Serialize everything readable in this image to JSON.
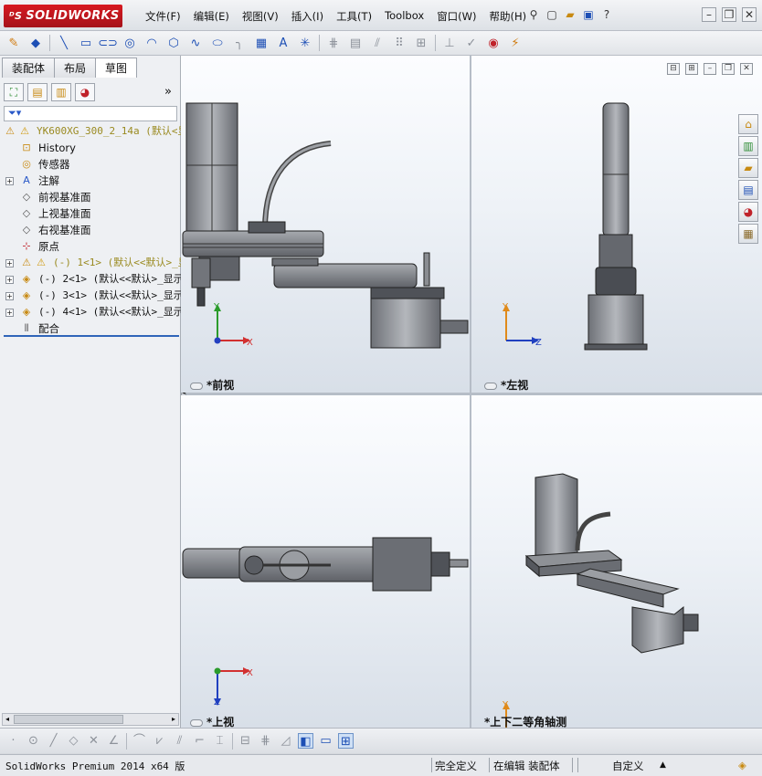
{
  "app": {
    "logo_text": "SOLIDWORKS",
    "menu": [
      "文件(F)",
      "编辑(E)",
      "视图(V)",
      "插入(I)",
      "工具(T)",
      "Toolbox",
      "窗口(W)",
      "帮助(H)"
    ],
    "title_tools": [
      "pin-icon",
      "new-document-icon",
      "open-icon",
      "save-icon",
      "help-icon"
    ],
    "window_controls": [
      "minimize-icon",
      "restore-icon",
      "close-icon"
    ]
  },
  "command_toolbar": [
    "smart-dimension-icon",
    "sketch-icon",
    "line-icon",
    "rectangle-icon",
    "slot-icon",
    "circle-icon",
    "arc-icon",
    "polygon-icon",
    "spline-icon",
    "ellipse-icon",
    "fillet-icon",
    "offset-icon",
    "text-icon",
    "point-icon",
    "trim-icon",
    "convert-icon",
    "mirror-icon",
    "linear-pattern-icon",
    "move-icon",
    "display-relations-icon",
    "repair-icon",
    "quick-snaps-icon",
    "rapid-sketch-icon"
  ],
  "left_panel": {
    "tabs": [
      "装配体",
      "布局",
      "草图"
    ],
    "active_tab": "草图",
    "panel_icons": [
      "feature-manager-icon",
      "property-manager-icon",
      "configuration-manager-icon",
      "display-manager-icon"
    ],
    "tree": [
      {
        "label": "YK600XG_300_2_14a  (默认<显",
        "icon": "assembly-warning-icon",
        "kind": "root",
        "expander": false
      },
      {
        "label": "History",
        "icon": "history-icon",
        "kind": "item",
        "expander": false
      },
      {
        "label": "传感器",
        "icon": "sensor-icon",
        "kind": "item",
        "expander": false
      },
      {
        "label": "注解",
        "icon": "annotation-icon",
        "kind": "item",
        "expander": true
      },
      {
        "label": "前视基准面",
        "icon": "plane-icon",
        "kind": "item",
        "expander": false
      },
      {
        "label": "上视基准面",
        "icon": "plane-icon",
        "kind": "item",
        "expander": false
      },
      {
        "label": "右视基准面",
        "icon": "plane-icon",
        "kind": "item",
        "expander": false
      },
      {
        "label": "原点",
        "icon": "origin-icon",
        "kind": "item",
        "expander": false
      },
      {
        "label": "(-) 1<1> (默认<<默认>_显",
        "icon": "part-warning-icon",
        "kind": "comp-warn",
        "expander": true
      },
      {
        "label": "(-) 2<1> (默认<<默认>_显示",
        "icon": "part-icon",
        "kind": "comp",
        "expander": true
      },
      {
        "label": "(-) 3<1> (默认<<默认>_显示",
        "icon": "part-icon",
        "kind": "comp",
        "expander": true
      },
      {
        "label": "(-) 4<1> (默认<<默认>_显示",
        "icon": "part-icon",
        "kind": "comp",
        "expander": true
      },
      {
        "label": "配合",
        "icon": "mates-icon",
        "kind": "item",
        "expander": false
      }
    ]
  },
  "viewports": {
    "front": "*前视",
    "left": "*左视",
    "top": "*上视",
    "iso": "*上下二等角轴测"
  },
  "triad": {
    "x": "X",
    "y": "Y",
    "z": "Z"
  },
  "task_pane_icons": [
    "home-icon",
    "design-library-icon",
    "file-explorer-icon",
    "view-palette-icon",
    "appearances-icon",
    "custom-properties-icon"
  ],
  "sketch_toolbar": [
    "point-icon",
    "circle-icon",
    "line-icon",
    "polygon-icon",
    "cross-icon",
    "angle-icon",
    "sketch-fillet-icon",
    "chamfer-icon",
    "centerline-icon",
    "corner-icon",
    "dimension-icon",
    "grid-icon",
    "plane-icon",
    "view-cube-icon",
    "window-single-icon",
    "window-four-icon"
  ],
  "status": {
    "version": "SolidWorks Premium 2014 x64 版",
    "definition": "完全定义",
    "editing": "在编辑 装配体",
    "units": "自定义"
  }
}
